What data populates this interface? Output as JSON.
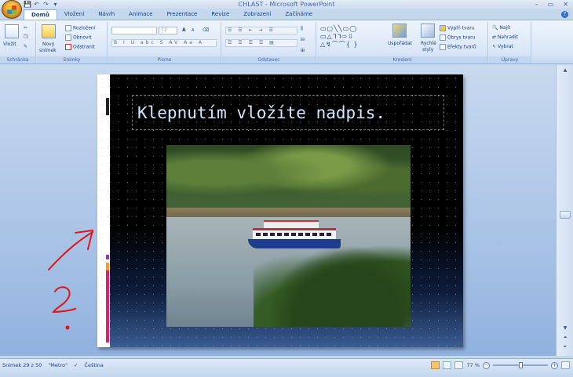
{
  "window": {
    "title": "CHLAST - Microsoft PowerPoint",
    "controls": [
      "–",
      "▭",
      "✕"
    ]
  },
  "qat": {
    "save": "💾",
    "undo": "↶",
    "redo": "↷",
    "more": "▾"
  },
  "tabs": [
    {
      "label": "Domů",
      "active": true
    },
    {
      "label": "Vložení"
    },
    {
      "label": "Návrh"
    },
    {
      "label": "Animace"
    },
    {
      "label": "Prezentace"
    },
    {
      "label": "Revize"
    },
    {
      "label": "Zobrazení"
    },
    {
      "label": "Začínáme"
    }
  ],
  "ribbon": {
    "clipboard": {
      "paste": "Vložit",
      "label": "Schránka"
    },
    "slides": {
      "new_slide_1": "Nový",
      "new_slide_2": "snímek",
      "layout": "Rozložení",
      "reset": "Obnovit",
      "delete": "Odstranit",
      "label": "Snímky"
    },
    "font": {
      "font_size": "72",
      "grow": "A",
      "shrink": "A",
      "format_row": "B I U abc S AV Aa A",
      "label": "Písmo"
    },
    "paragraph": {
      "label": "Odstavec"
    },
    "drawing": {
      "arrange": "Uspořádat",
      "quick_styles_1": "Rychlé",
      "quick_styles_2": "styly",
      "fill": "Výplň tvaru",
      "outline": "Obrys tvaru",
      "effects": "Efekty tvarů",
      "label": "Kreslení"
    },
    "editing": {
      "find": "Najít",
      "replace": "Nahradit",
      "select": "Vybrat",
      "label": "Úpravy"
    }
  },
  "slide": {
    "title_placeholder": "Klepnutím vložíte nadpis."
  },
  "annotation": {
    "question": "?"
  },
  "status": {
    "slide_info": "Snímek 29 z 50",
    "theme": "\"Metro\"",
    "language": "Čeština",
    "zoom": "77 %"
  },
  "zoom_level": 0.77
}
